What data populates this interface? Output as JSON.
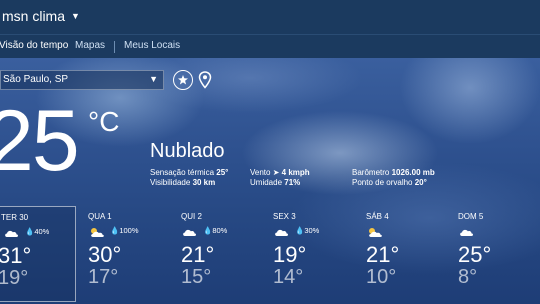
{
  "app": {
    "title": "msn clima"
  },
  "nav": {
    "items": [
      {
        "label": "Visão do tempo"
      },
      {
        "label": "Mapas"
      },
      {
        "label": "Meus Locais"
      }
    ]
  },
  "location": {
    "value": "São Paulo, SP"
  },
  "current": {
    "temperature": "25",
    "unit": "°C",
    "condition": "Nublado",
    "feels_like_label": "Sensação térmica",
    "feels_like": "25°",
    "visibility_label": "Visibilidade",
    "visibility": "30 km",
    "wind_label": "Vento",
    "wind": "4 kmph",
    "humidity_label": "Umidade",
    "humidity": "71%",
    "barometer_label": "Barômetro",
    "barometer": "1026.00 mb",
    "dew_point_label": "Ponto de orvalho",
    "dew_point": "20°"
  },
  "forecast": [
    {
      "day": "TER 30",
      "icon": "partly-cloudy-icon",
      "precip": "40%",
      "high": "31°",
      "low": "19°",
      "selected": true
    },
    {
      "day": "QUA 1",
      "icon": "sun-cloud-icon",
      "precip": "100%",
      "high": "30°",
      "low": "17°"
    },
    {
      "day": "QUI 2",
      "icon": "partly-cloudy-icon",
      "precip": "80%",
      "high": "21°",
      "low": "15°"
    },
    {
      "day": "SEX 3",
      "icon": "partly-cloudy-icon",
      "precip": "30%",
      "high": "19°",
      "low": "14°"
    },
    {
      "day": "SÁB 4",
      "icon": "sun-cloud-icon",
      "precip": "",
      "high": "21°",
      "low": "10°"
    },
    {
      "day": "DOM 5",
      "icon": "partly-cloudy-icon",
      "precip": "",
      "high": "25°",
      "low": "8°"
    }
  ]
}
